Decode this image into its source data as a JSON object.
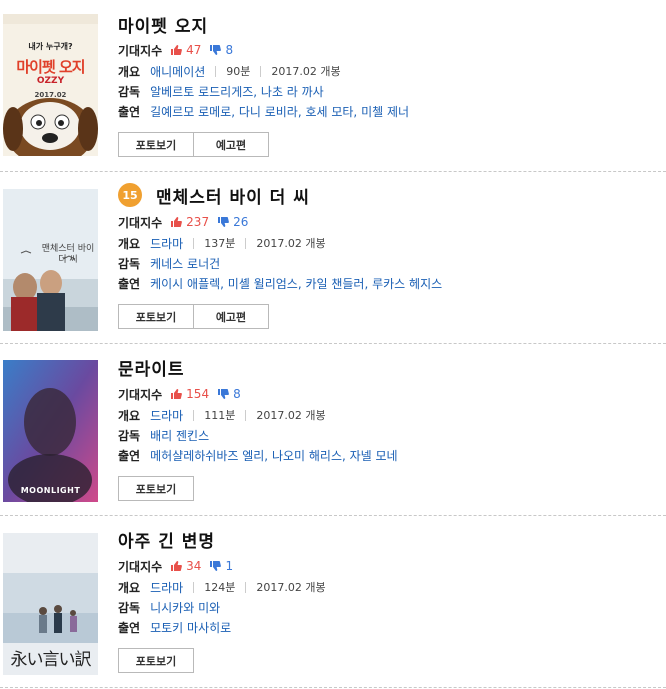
{
  "labels": {
    "expect": "기대지수",
    "overview": "개요",
    "director": "감독",
    "cast": "출연",
    "photo_btn": "포토보기",
    "trailer_btn": "예고편"
  },
  "colors": {
    "like": "#e8504a",
    "dislike": "#3a78d8",
    "link": "#1a5fb4",
    "age_badge": "#f0a030"
  },
  "movies": [
    {
      "title": "마이펫 오지",
      "poster_text": "마이펫 오지",
      "poster_sub": "OZZY",
      "poster_date": "2017.02",
      "poster_top": "내가 누구개?",
      "likes": "47",
      "dislikes": "8",
      "genre": "애니메이션",
      "runtime": "90분",
      "release": "2017.02 개봉",
      "director": "알베르토 로드리게즈, 나초 라 까사",
      "cast": "길예르모 로메로, 다니 로비라, 호세 모타, 미첼 제너",
      "has_trailer": true
    },
    {
      "title": "맨체스터 바이 더 씨",
      "age": "15",
      "poster_text": "맨체스터 바이 더 씨",
      "likes": "237",
      "dislikes": "26",
      "genre": "드라마",
      "runtime": "137분",
      "release": "2017.02 개봉",
      "director": "케네스 로너건",
      "cast": "케이시 애플렉, 미셸 윌리엄스, 카일 챈들러, 루카스 헤지스",
      "has_trailer": true
    },
    {
      "title": "문라이트",
      "poster_text": "MOONLIGHT",
      "likes": "154",
      "dislikes": "8",
      "genre": "드라마",
      "runtime": "111분",
      "release": "2017.02 개봉",
      "director": "배리 젠킨스",
      "cast": "메허샬레하쉬바즈 엘리, 나오미 해리스, 자넬 모네",
      "has_trailer": false
    },
    {
      "title": "아주 긴 변명",
      "poster_text": "永い言い訳",
      "likes": "34",
      "dislikes": "1",
      "genre": "드라마",
      "runtime": "124분",
      "release": "2017.02 개봉",
      "director": "니시카와 미와",
      "cast": "모토키 마사히로",
      "has_trailer": false
    }
  ]
}
